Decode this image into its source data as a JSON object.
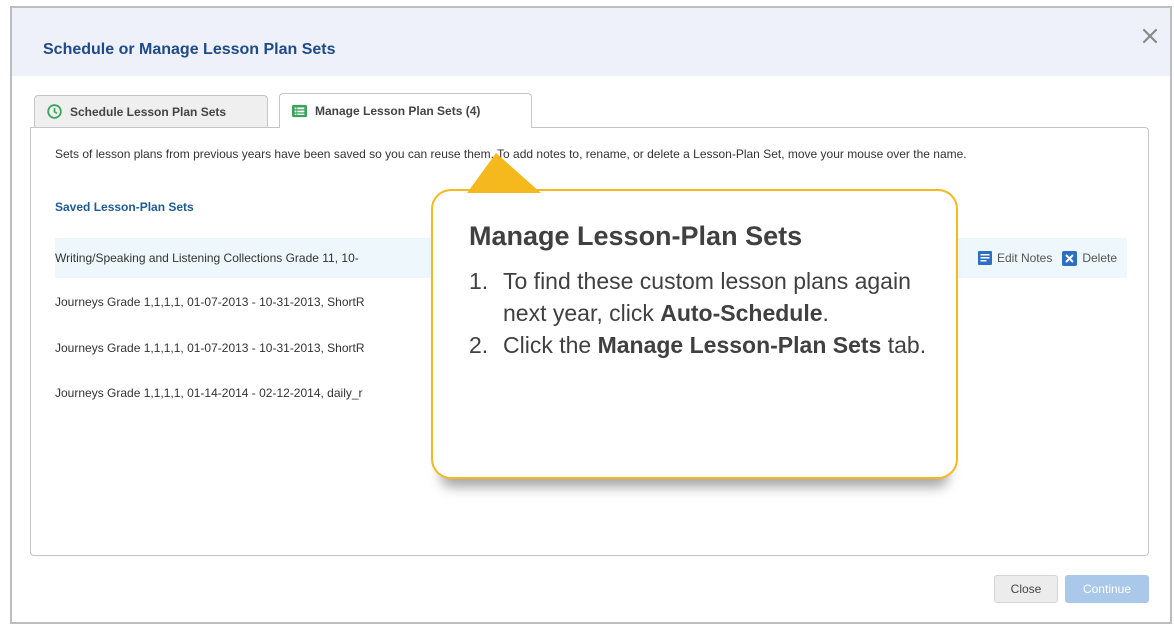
{
  "dialog": {
    "title": "Schedule or Manage Lesson Plan Sets",
    "close_icon": "close-x-icon"
  },
  "tabs": [
    {
      "label": "Schedule Lesson Plan Sets",
      "icon": "clock-icon",
      "active": false
    },
    {
      "label": "Manage Lesson Plan Sets (4)",
      "icon": "list-icon",
      "active": true
    }
  ],
  "panel": {
    "intro": "Sets of lesson plans from previous years have been saved so you can reuse them. To add notes to, rename, or delete a Lesson-Plan Set, move your mouse over the name.",
    "section_title": "Saved Lesson-Plan Sets",
    "rows": [
      {
        "name": "Writing/Speaking and Listening Collections Grade 11, 10-",
        "highlighted": true
      },
      {
        "name": "Journeys Grade 1,1,1,1, 01-07-2013 - 10-31-2013, ShortR",
        "highlighted": false
      },
      {
        "name": "Journeys Grade 1,1,1,1, 01-07-2013 - 10-31-2013, ShortR",
        "highlighted": false
      },
      {
        "name": "Journeys Grade 1,1,1,1, 01-14-2014 - 02-12-2014, daily_r",
        "highlighted": false
      }
    ],
    "row_actions": {
      "edit_notes": "Edit Notes",
      "delete": "Delete"
    }
  },
  "buttons": {
    "close": "Close",
    "continue": "Continue"
  },
  "callout": {
    "title": "Manage Lesson-Plan Sets",
    "step1_num": "1.",
    "step1_pre": "To find these custom lesson plans again next year, click ",
    "step1_bold": "Auto-Schedule",
    "step1_post": ".",
    "step2_num": "2.",
    "step2_pre": "Click the ",
    "step2_bold": "Manage Lesson-Plan Sets",
    "step2_post": " tab."
  },
  "colors": {
    "accent": "#1e4a8a",
    "callout_border": "#f6b91d",
    "continue_disabled": "#a9c8ea"
  }
}
